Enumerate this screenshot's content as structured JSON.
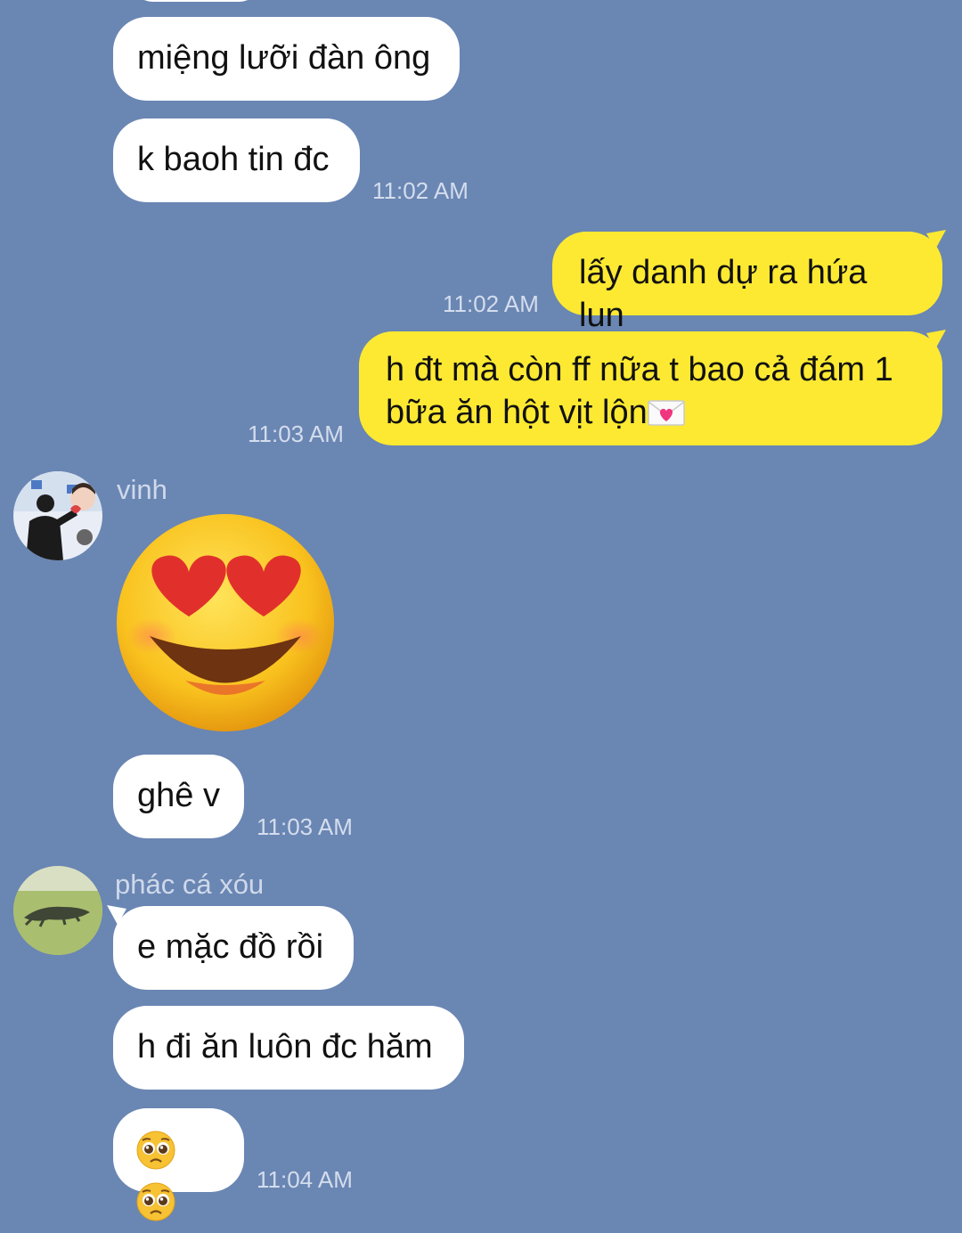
{
  "messages": {
    "m1": "miệng lưỡi đàn ông",
    "m2": "k baoh tin đc",
    "t1": "11:02 AM",
    "m3": "lấy danh dự ra hứa lun",
    "t2": "11:02 AM",
    "m4_line1": "h đt mà còn ff nữa t bao cả đám 1",
    "m4_line2": "bữa ăn hột vịt lộn",
    "t3": "11:03 AM",
    "sender1": "vinh",
    "m5_sticker": "heart-eyes-sticker",
    "m6": "ghê v",
    "t4": "11:03 AM",
    "sender2": "phác cá xóu",
    "m7": "e mặc đồ rồi",
    "m8": "h đi ăn luôn đc hăm",
    "m9_emoji": "pleading-face-icon pleading-face-icon",
    "t5": "11:04 AM"
  },
  "icons": {
    "love_letter": "love-letter-icon",
    "sticker": "heart-eyes-sticker",
    "pleading": "pleading-face-icon"
  },
  "colors": {
    "background": "#6a86b3",
    "incoming_bubble": "#ffffff",
    "outgoing_bubble": "#fde932",
    "timestamp": "#d4dded"
  }
}
